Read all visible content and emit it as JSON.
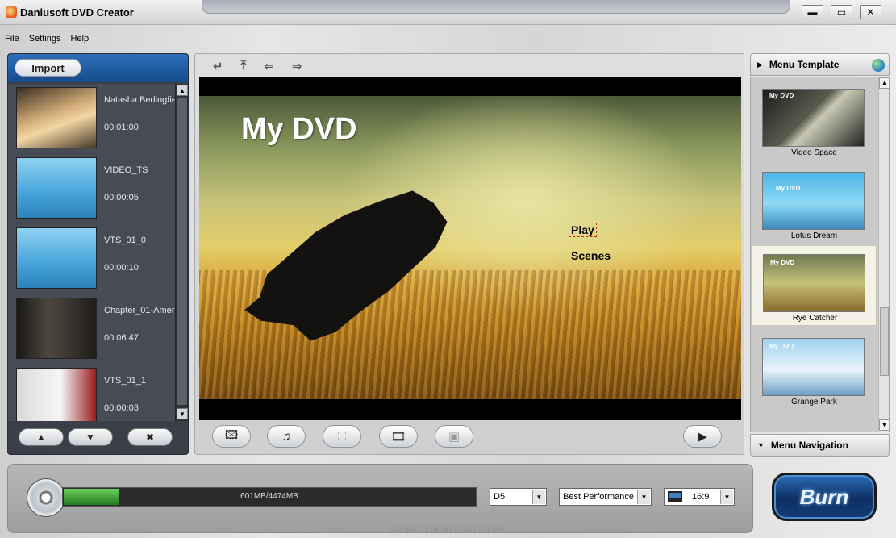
{
  "app": {
    "title": "Daniusoft DVD Creator"
  },
  "window_buttons": {
    "minimize": "▬",
    "maximize": "▭",
    "close": "✕"
  },
  "menubar": [
    "File",
    "Settings",
    "Help"
  ],
  "left_panel": {
    "import_label": "Import",
    "clips": [
      {
        "name": "Natasha Bedingfie",
        "duration": "00:01:00",
        "thumb": "#b58a5a"
      },
      {
        "name": "VIDEO_TS",
        "duration": "00:00:05",
        "thumb": "#5fb4e0"
      },
      {
        "name": "VTS_01_0",
        "duration": "00:00:10",
        "thumb": "#5fb4e0"
      },
      {
        "name": "Chapter_01-Amer",
        "duration": "00:06:47",
        "thumb": "#2a2622"
      },
      {
        "name": "VTS_01_1",
        "duration": "00:00:03",
        "thumb": "#c0c0c0"
      }
    ],
    "buttons": {
      "move_up": "▲",
      "move_down": "▼",
      "delete": "✖"
    }
  },
  "preview": {
    "nav": [
      "↵",
      "⤒",
      "⇐",
      "⇒"
    ],
    "dvd_title": "My DVD",
    "menu_items": {
      "play": "Play",
      "scenes": "Scenes"
    }
  },
  "toolbar": {
    "background": "🖾",
    "music": "♫",
    "fullscreen": "⛶",
    "chapters": "🎞",
    "export": "▣",
    "play": "▶"
  },
  "right_panel": {
    "header": "Menu Template",
    "templates": [
      {
        "name": "Video Space",
        "label": "My DVD",
        "color": "#3a3a3a"
      },
      {
        "name": "Lotus Dream",
        "label": "My DVD",
        "color": "#5bbde4"
      },
      {
        "name": "Rye Catcher",
        "label": "My DVD",
        "color": "#8a8f55"
      },
      {
        "name": "Grange Park",
        "label": "My DVD",
        "color": "#9fd0ef"
      }
    ],
    "footer": "Menu Navigation"
  },
  "bottom": {
    "capacity_text": "601MB/4474MB",
    "capacity_fraction": 0.134,
    "disc_type": "D5",
    "quality": "Best Performance",
    "aspect": "16:9",
    "burn_label": "Burn"
  },
  "watermark": "GEARDOWNLOAD.COM"
}
